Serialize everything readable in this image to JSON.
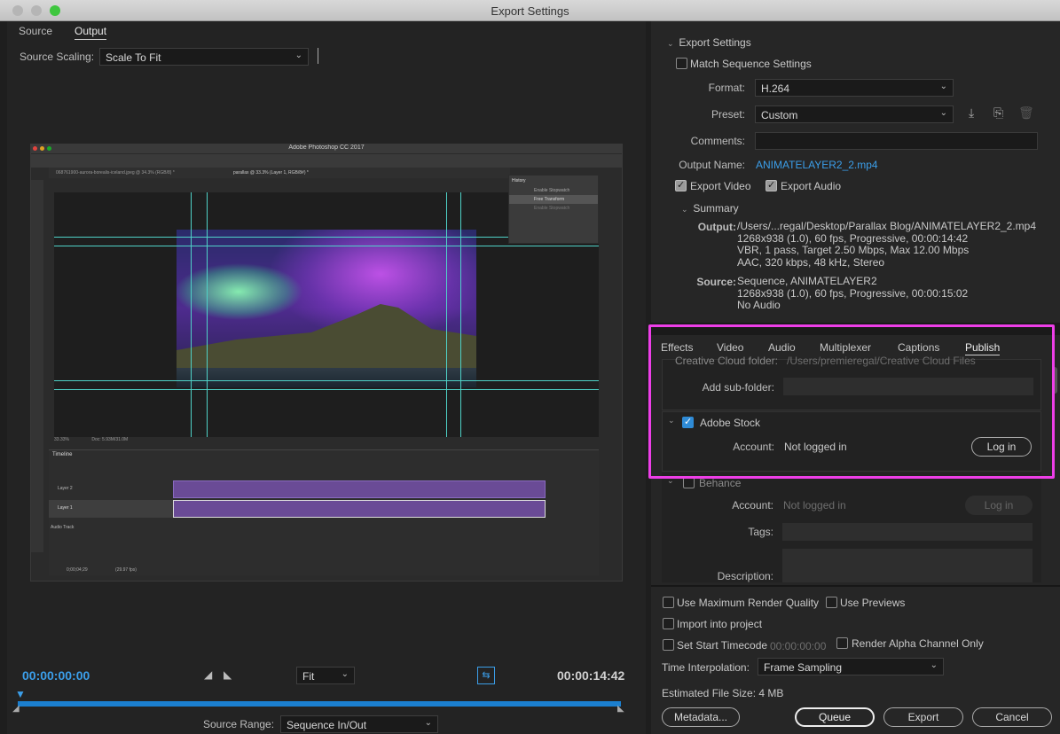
{
  "window": {
    "title": "Export Settings"
  },
  "left": {
    "tabs": [
      {
        "label": "Source"
      },
      {
        "label": "Output"
      }
    ],
    "source_scaling": {
      "label": "Source Scaling:",
      "value": "Scale To Fit"
    },
    "preview": {
      "app_title": "Adobe Photoshop CC 2017",
      "doc_tab_1": "068761900-aurora-borealis-iceland.jpeg @ 34.3% (RGB/8) *",
      "doc_tab_2": "parallax @ 33.3% (Layer 1, RGB/8#) *",
      "history_title": "History",
      "history_items": [
        "Enable Stopwatch",
        "Free Transform",
        "Enable Stopwatch"
      ],
      "timeline_title": "Timeline",
      "layers": [
        "Layer 2",
        "Layer 1",
        "Audio Track"
      ],
      "zoom": "33.33%",
      "doc_size": "Doc: 5.93M/31.0M",
      "time": "0;00;04;29",
      "fps": "(29.97 fps)"
    },
    "current_time": "00:00:00:00",
    "end_time": "00:00:14:42",
    "fit": {
      "value": "Fit"
    },
    "source_range": {
      "label": "Source Range:",
      "value": "Sequence In/Out"
    }
  },
  "export_settings": {
    "title": "Export Settings",
    "match_sequence": "Match Sequence Settings",
    "format": {
      "label": "Format:",
      "value": "H.264"
    },
    "preset": {
      "label": "Preset:",
      "value": "Custom"
    },
    "comments": {
      "label": "Comments:"
    },
    "output_name": {
      "label": "Output Name:",
      "value": "ANIMATELAYER2_2.mp4"
    },
    "export_video": "Export Video",
    "export_audio": "Export Audio",
    "summary": {
      "title": "Summary",
      "output_label": "Output:",
      "output_lines": "/Users/...regal/Desktop/Parallax Blog/ANIMATELAYER2_2.mp4\n1268x938 (1.0), 60 fps, Progressive, 00:00:14:42\nVBR, 1 pass, Target 2.50 Mbps, Max 12.00 Mbps\nAAC, 320 kbps, 48 kHz, Stereo",
      "source_label": "Source:",
      "source_lines": "Sequence, ANIMATELAYER2\n1268x938 (1.0), 60 fps, Progressive, 00:00:15:02\nNo Audio"
    }
  },
  "publish": {
    "tabs": [
      {
        "label": "Effects"
      },
      {
        "label": "Video"
      },
      {
        "label": "Audio"
      },
      {
        "label": "Multiplexer"
      },
      {
        "label": "Captions"
      },
      {
        "label": "Publish"
      }
    ],
    "cc_folder": {
      "label": "Creative Cloud folder:",
      "value": "/Users/premieregal/Creative Cloud Files"
    },
    "sub_folder": {
      "label": "Add sub-folder:"
    },
    "adobe_stock": {
      "title": "Adobe Stock",
      "account_label": "Account:",
      "account_value": "Not logged in",
      "login": "Log in"
    },
    "behance": {
      "title": "Behance",
      "account_label": "Account:",
      "account_value": "Not logged in",
      "login": "Log in",
      "tags_label": "Tags:",
      "description_label": "Description:"
    }
  },
  "bottom": {
    "max_render": "Use Maximum Render Quality",
    "use_previews": "Use Previews",
    "import_project": "Import into project",
    "start_timecode": "Set Start Timecode",
    "start_timecode_value": "00:00:00:00",
    "render_alpha": "Render Alpha Channel Only",
    "time_interp": {
      "label": "Time Interpolation:",
      "value": "Frame Sampling"
    },
    "file_size": {
      "label": "Estimated File Size:",
      "value": "4 MB"
    },
    "metadata": "Metadata...",
    "queue": "Queue",
    "export": "Export",
    "cancel": "Cancel"
  },
  "colors": {
    "accent_blue": "#3b9ee9",
    "highlight": "#ee3ee8"
  }
}
